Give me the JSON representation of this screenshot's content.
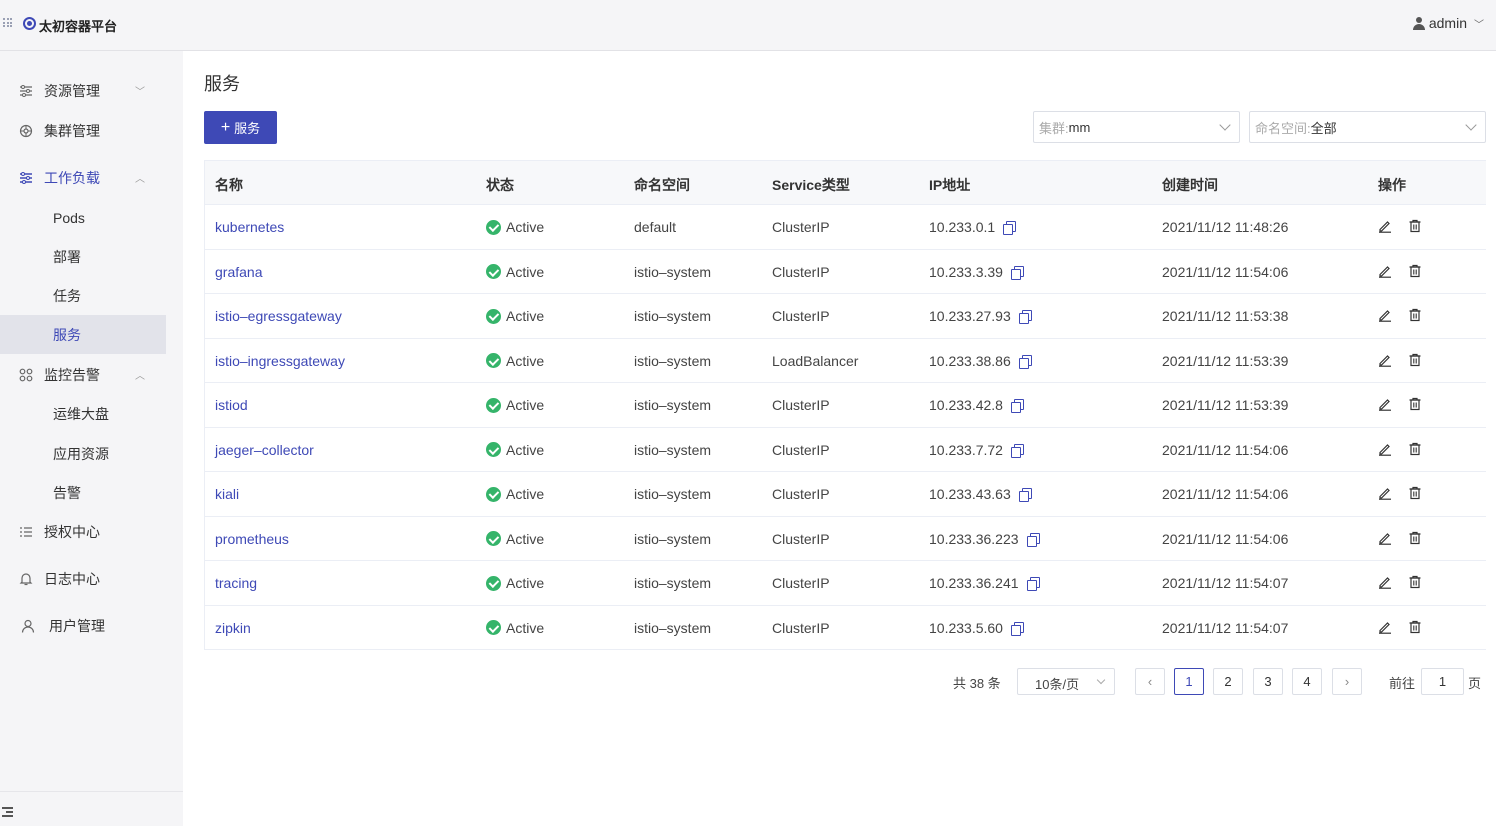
{
  "app": {
    "title": "太初容器平台",
    "user": "admin"
  },
  "sidebar": {
    "items": [
      {
        "label": "资源管理",
        "icon": "sliders-icon",
        "chevron": "﹀"
      },
      {
        "label": "集群管理",
        "icon": "cluster-icon"
      },
      {
        "label": "工作负载",
        "icon": "workload-icon",
        "chevron": "︿"
      },
      {
        "label": "Pods"
      },
      {
        "label": "部署"
      },
      {
        "label": "任务"
      },
      {
        "label": "服务"
      },
      {
        "label": "监控告警",
        "icon": "grid-icon",
        "chevron": "︿"
      },
      {
        "label": "运维大盘"
      },
      {
        "label": "应用资源"
      },
      {
        "label": "告警"
      },
      {
        "label": "授权中心",
        "icon": "list-icon"
      },
      {
        "label": "日志中心",
        "icon": "bell-icon"
      },
      {
        "label": "用户管理",
        "icon": "user-icon"
      }
    ]
  },
  "page": {
    "title": "服务",
    "add_button": "服务",
    "add_plus": "+"
  },
  "filters": {
    "cluster_prefix": "集群:",
    "cluster_value": "mm",
    "namespace_prefix": "命名空间:",
    "namespace_value": "全部"
  },
  "table": {
    "headers": [
      "名称",
      "状态",
      "命名空间",
      "Service类型",
      "IP地址",
      "创建时间",
      "操作"
    ],
    "rows": [
      {
        "name": "kubernetes",
        "status": "Active",
        "namespace": "default",
        "type": "ClusterIP",
        "ip": "10.233.0.1",
        "created": "2021/11/12 11:48:26"
      },
      {
        "name": "grafana",
        "status": "Active",
        "namespace": "istio–system",
        "type": "ClusterIP",
        "ip": "10.233.3.39",
        "created": "2021/11/12 11:54:06"
      },
      {
        "name": "istio–egressgateway",
        "status": "Active",
        "namespace": "istio–system",
        "type": "ClusterIP",
        "ip": "10.233.27.93",
        "created": "2021/11/12 11:53:38"
      },
      {
        "name": "istio–ingressgateway",
        "status": "Active",
        "namespace": "istio–system",
        "type": "LoadBalancer",
        "ip": "10.233.38.86",
        "created": "2021/11/12 11:53:39"
      },
      {
        "name": "istiod",
        "status": "Active",
        "namespace": "istio–system",
        "type": "ClusterIP",
        "ip": "10.233.42.8",
        "created": "2021/11/12 11:53:39"
      },
      {
        "name": "jaeger–collector",
        "status": "Active",
        "namespace": "istio–system",
        "type": "ClusterIP",
        "ip": "10.233.7.72",
        "created": "2021/11/12 11:54:06"
      },
      {
        "name": "kiali",
        "status": "Active",
        "namespace": "istio–system",
        "type": "ClusterIP",
        "ip": "10.233.43.63",
        "created": "2021/11/12 11:54:06"
      },
      {
        "name": "prometheus",
        "status": "Active",
        "namespace": "istio–system",
        "type": "ClusterIP",
        "ip": "10.233.36.223",
        "created": "2021/11/12 11:54:06"
      },
      {
        "name": "tracing",
        "status": "Active",
        "namespace": "istio–system",
        "type": "ClusterIP",
        "ip": "10.233.36.241",
        "created": "2021/11/12 11:54:07"
      },
      {
        "name": "zipkin",
        "status": "Active",
        "namespace": "istio–system",
        "type": "ClusterIP",
        "ip": "10.233.5.60",
        "created": "2021/11/12 11:54:07"
      }
    ]
  },
  "pagination": {
    "total": "共 38 条",
    "page_size": "10条/页",
    "pages": [
      "1",
      "2",
      "3",
      "4"
    ],
    "current": "1",
    "prev": "‹",
    "next": "›",
    "goto_label": "前往",
    "goto_value": "1",
    "page_suffix": "页"
  },
  "colors": {
    "accent": "#3e49b6",
    "success": "#35b46a",
    "sidebar_bg": "#f5f5f7"
  }
}
